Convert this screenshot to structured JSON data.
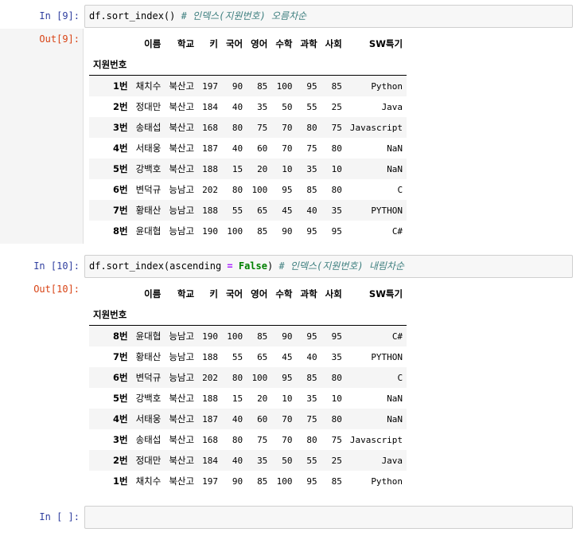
{
  "cells": [
    {
      "in_prompt": "In [9]:",
      "code": {
        "obj": "df.sort_index()",
        "comment": "# 인덱스(지원번호) 오름차순"
      },
      "out_prompt": "Out[9]:",
      "table": {
        "columns": [
          "이름",
          "학교",
          "키",
          "국어",
          "영어",
          "수학",
          "과학",
          "사회",
          "SW특기"
        ],
        "index_name": "지원번호",
        "rows": [
          [
            "1번",
            "채치수",
            "북산고",
            "197",
            "90",
            "85",
            "100",
            "95",
            "85",
            "Python"
          ],
          [
            "2번",
            "정대만",
            "북산고",
            "184",
            "40",
            "35",
            "50",
            "55",
            "25",
            "Java"
          ],
          [
            "3번",
            "송태섭",
            "북산고",
            "168",
            "80",
            "75",
            "70",
            "80",
            "75",
            "Javascript"
          ],
          [
            "4번",
            "서태웅",
            "북산고",
            "187",
            "40",
            "60",
            "70",
            "75",
            "80",
            "NaN"
          ],
          [
            "5번",
            "강백호",
            "북산고",
            "188",
            "15",
            "20",
            "10",
            "35",
            "10",
            "NaN"
          ],
          [
            "6번",
            "변덕규",
            "능남고",
            "202",
            "80",
            "100",
            "95",
            "85",
            "80",
            "C"
          ],
          [
            "7번",
            "황태산",
            "능남고",
            "188",
            "55",
            "65",
            "45",
            "40",
            "35",
            "PYTHON"
          ],
          [
            "8번",
            "윤대협",
            "능남고",
            "190",
            "100",
            "85",
            "90",
            "95",
            "95",
            "C#"
          ]
        ]
      }
    },
    {
      "in_prompt": "In [10]:",
      "code": {
        "fn": "df.sort_index(ascending ",
        "op": "=",
        "kw": " False",
        "close": ")",
        "comment": " # 인덱스(지원번호) 내림차순"
      },
      "out_prompt": "Out[10]:",
      "table": {
        "columns": [
          "이름",
          "학교",
          "키",
          "국어",
          "영어",
          "수학",
          "과학",
          "사회",
          "SW특기"
        ],
        "index_name": "지원번호",
        "rows": [
          [
            "8번",
            "윤대협",
            "능남고",
            "190",
            "100",
            "85",
            "90",
            "95",
            "95",
            "C#"
          ],
          [
            "7번",
            "황태산",
            "능남고",
            "188",
            "55",
            "65",
            "45",
            "40",
            "35",
            "PYTHON"
          ],
          [
            "6번",
            "변덕규",
            "능남고",
            "202",
            "80",
            "100",
            "95",
            "85",
            "80",
            "C"
          ],
          [
            "5번",
            "강백호",
            "북산고",
            "188",
            "15",
            "20",
            "10",
            "35",
            "10",
            "NaN"
          ],
          [
            "4번",
            "서태웅",
            "북산고",
            "187",
            "40",
            "60",
            "70",
            "75",
            "80",
            "NaN"
          ],
          [
            "3번",
            "송태섭",
            "북산고",
            "168",
            "80",
            "75",
            "70",
            "80",
            "75",
            "Javascript"
          ],
          [
            "2번",
            "정대만",
            "북산고",
            "184",
            "40",
            "35",
            "50",
            "55",
            "25",
            "Java"
          ],
          [
            "1번",
            "채치수",
            "북산고",
            "197",
            "90",
            "85",
            "100",
            "95",
            "85",
            "Python"
          ]
        ]
      }
    }
  ],
  "empty_cell": {
    "in_prompt": "In [ ]:",
    "code": ""
  }
}
